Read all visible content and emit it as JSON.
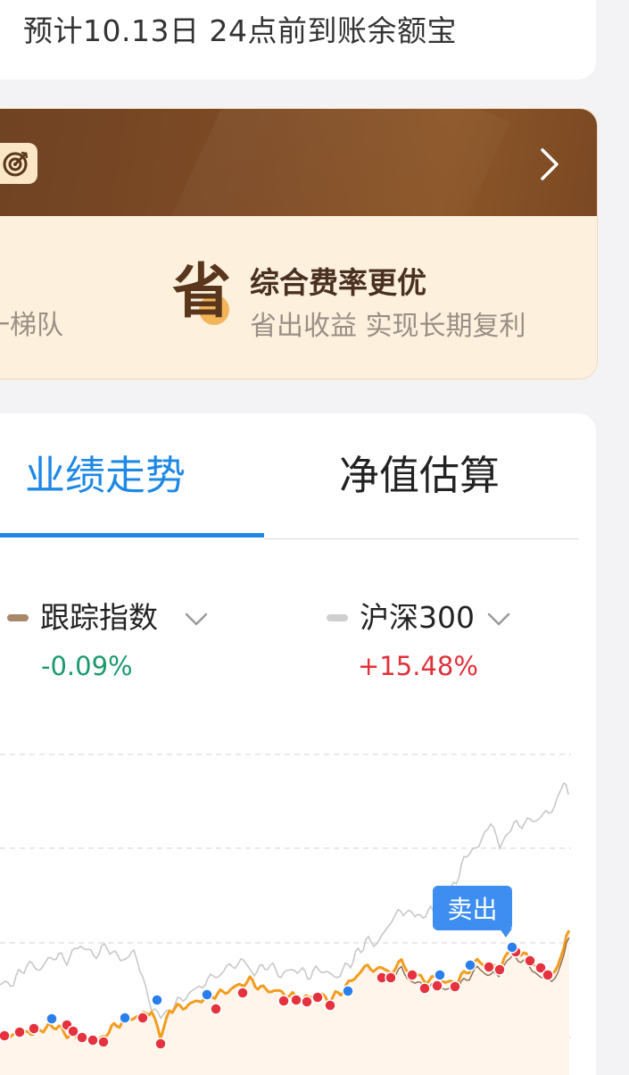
{
  "arrival": {
    "text": "预计10.13日 24点前到账余额宝"
  },
  "promo": {
    "target_icon": "target-icon",
    "chevron_icon": "chevron-right-icon",
    "ladder_text": "一梯队",
    "save_glyph": "省",
    "benefit_title": "综合费率更优",
    "benefit_sub": "省出收益 实现长期复利",
    "colors": {
      "header": "#7e4b25",
      "body": "#fdf1dd",
      "badge": "#fbe7c6"
    }
  },
  "tabs": [
    {
      "label": "业绩走势",
      "active": true
    },
    {
      "label": "净值估算",
      "active": false
    }
  ],
  "legend": [
    {
      "label": "跟踪指数",
      "value": "-0.09%",
      "color": "#a9876a",
      "value_color": "#1a9a6c"
    },
    {
      "label": "沪深300",
      "value": "+15.48%",
      "color": "#cfcfcf",
      "value_color": "#e0313a"
    }
  ],
  "sell_tag": "卖出",
  "chart_data": {
    "type": "line",
    "series": [
      {
        "name": "跟踪指数",
        "color": "#f39c1e"
      },
      {
        "name": "沪深300",
        "color": "#c8c8c8"
      }
    ],
    "markers": {
      "buy_color": "#e5323e",
      "sell_color": "#2a7fec"
    },
    "grid": true
  }
}
